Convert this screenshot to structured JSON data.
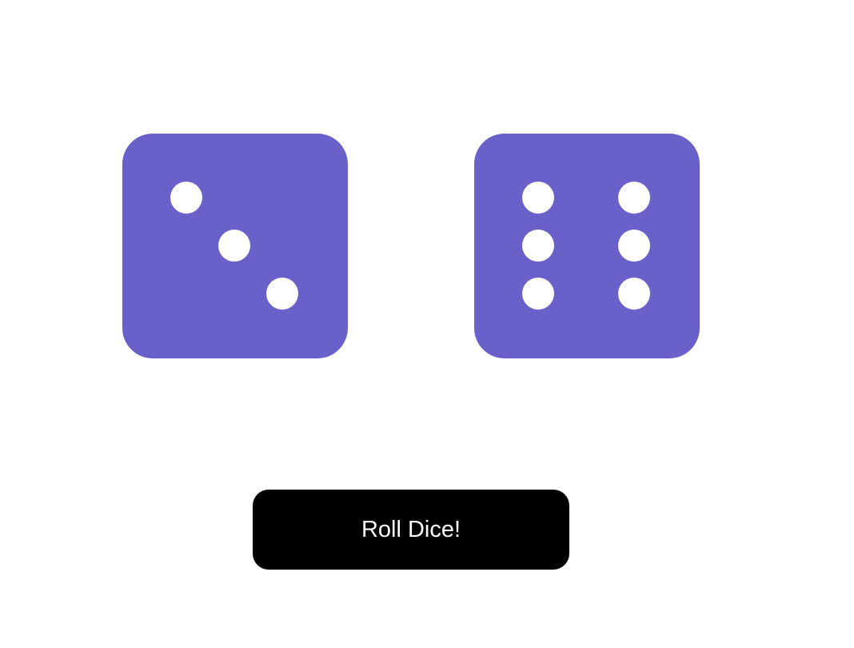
{
  "dice": [
    {
      "value": 3,
      "color": "#6a60c9",
      "pip_color": "#ffffff"
    },
    {
      "value": 6,
      "color": "#6a60c9",
      "pip_color": "#ffffff"
    }
  ],
  "roll_button": {
    "label": "Roll Dice!",
    "background": "#000000",
    "text_color": "#ffffff"
  }
}
